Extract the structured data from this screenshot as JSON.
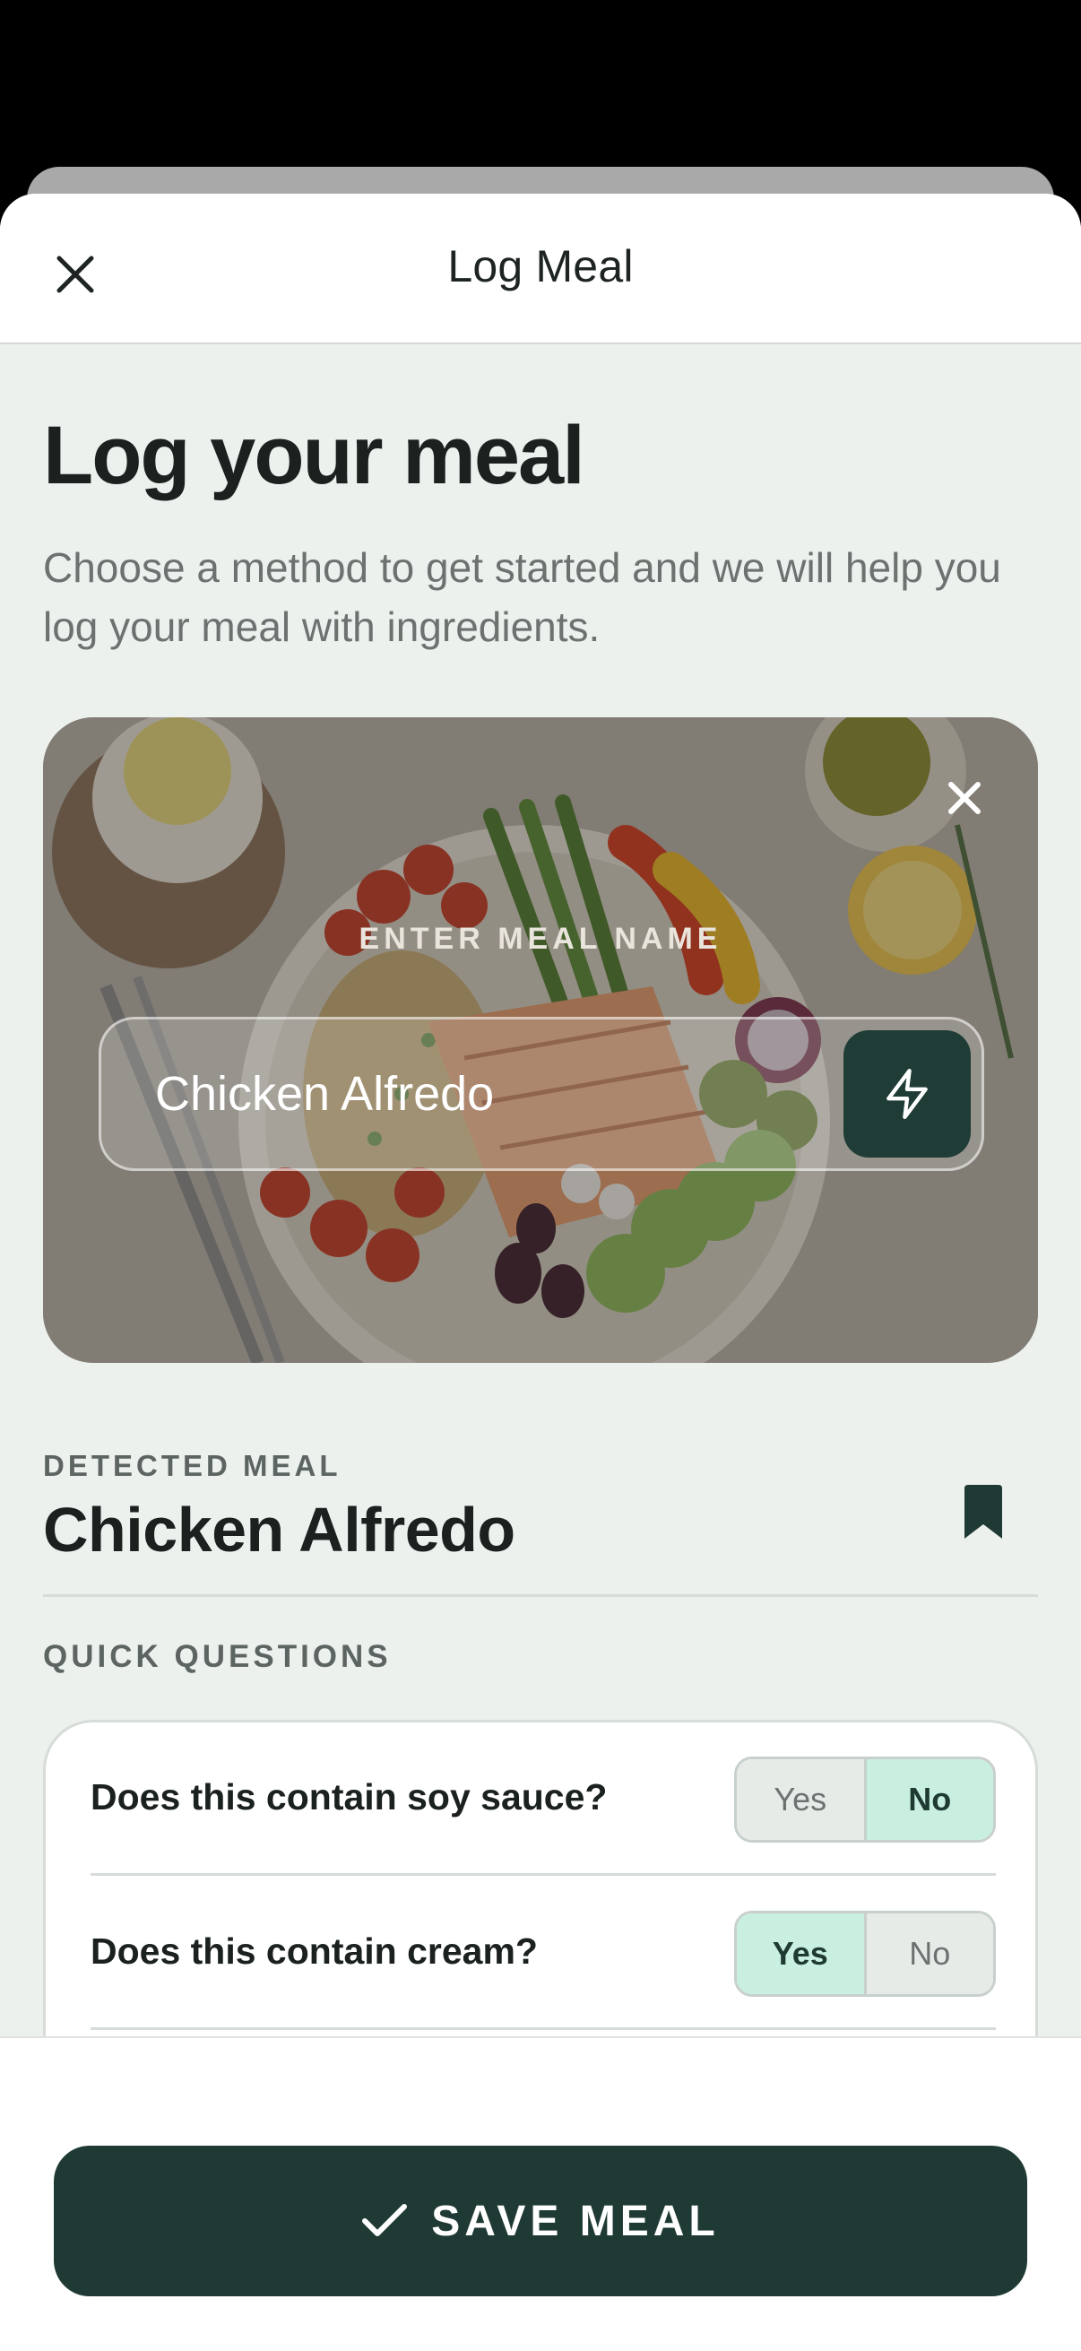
{
  "header": {
    "title": "Log Meal"
  },
  "page": {
    "title": "Log your meal",
    "subtitle": "Choose a method to get started and we will help you log your meal with ingredients."
  },
  "photo_card": {
    "label": "ENTER MEAL NAME",
    "meal_name_value": "Chicken Alfredo",
    "close_icon": "close-icon",
    "submit_icon": "lightning-bolt-icon"
  },
  "detected": {
    "label": "DETECTED MEAL",
    "title": "Chicken Alfredo",
    "bookmark_icon": "bookmark-icon"
  },
  "quick_questions": {
    "label": "QUICK QUESTIONS",
    "items": [
      {
        "question": "Does this contain soy sauce?",
        "yes": "Yes",
        "no": "No",
        "selected": "No"
      },
      {
        "question": "Does this contain cream?",
        "yes": "Yes",
        "no": "No",
        "selected": "Yes"
      }
    ]
  },
  "footer": {
    "save_label": "SAVE MEAL",
    "save_icon": "checkmark-icon"
  },
  "colors": {
    "accent_dark": "#1f3a34",
    "selected_toggle": "#c8efe0",
    "background": "#edf1ee"
  }
}
